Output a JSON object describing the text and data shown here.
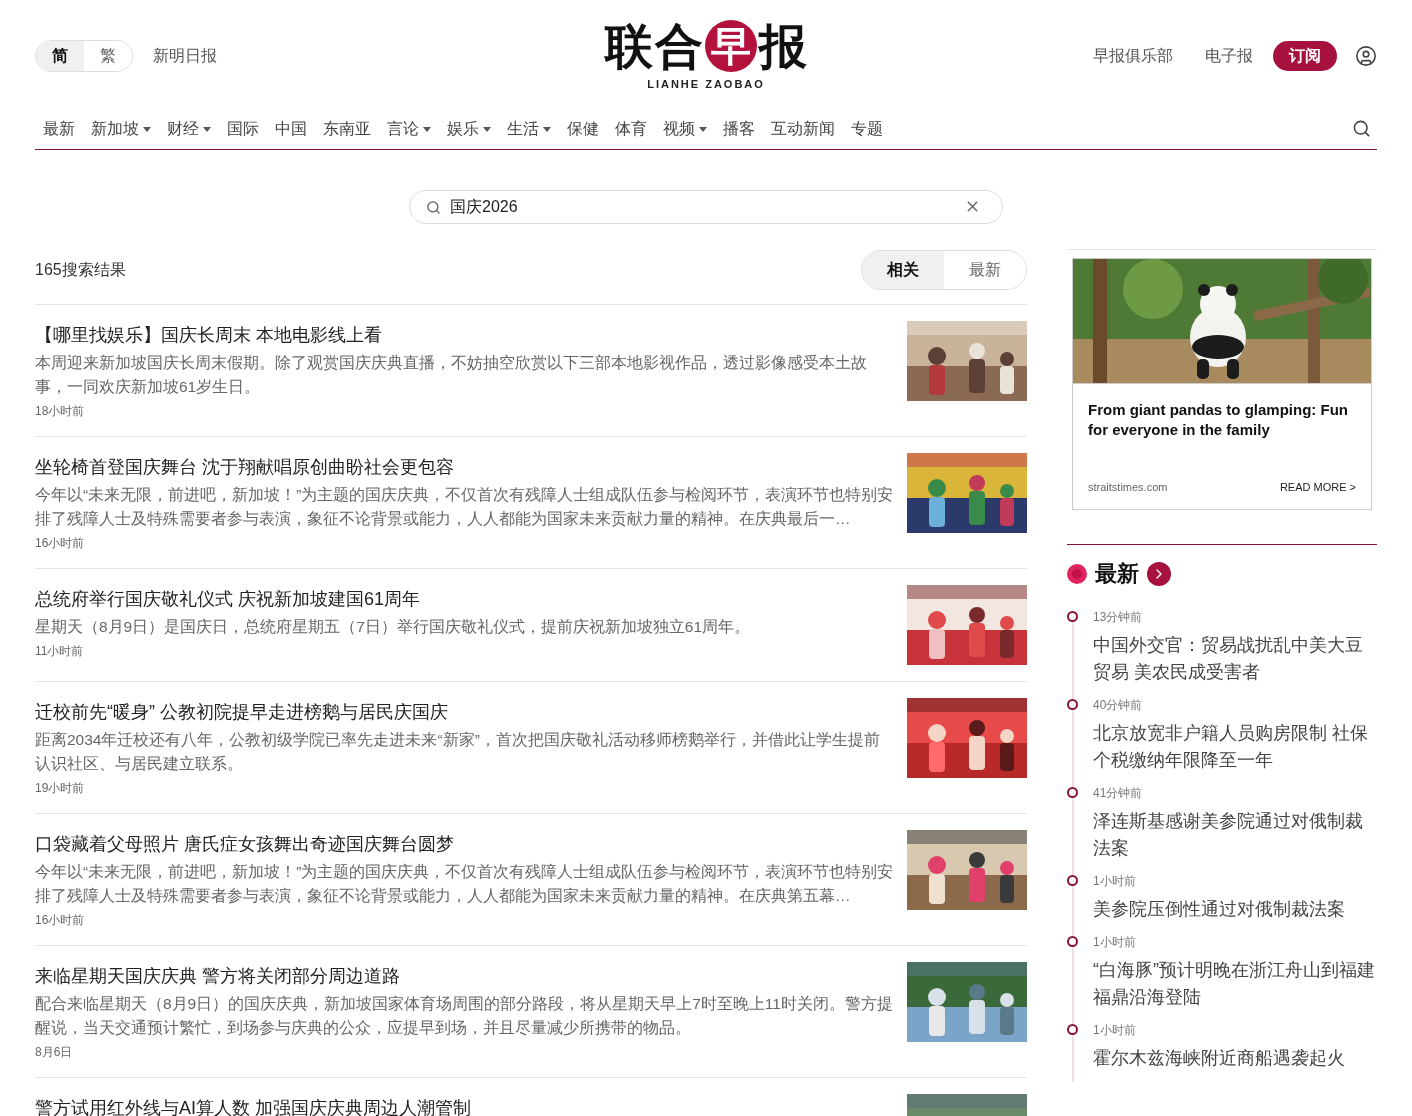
{
  "language_toggle": [
    {
      "label": "简",
      "selected": true
    },
    {
      "label": "繁",
      "selected": false
    }
  ],
  "top_link": "新明日报",
  "logo": {
    "parts": [
      {
        "text": "联",
        "kind": "plain"
      },
      {
        "text": "合",
        "kind": "plain"
      },
      {
        "text": "早",
        "kind": "circled"
      },
      {
        "text": "报",
        "kind": "plain"
      }
    ],
    "subtitle": "LIANHE ZAOBAO"
  },
  "header_links": [
    "早报俱乐部",
    "电子报"
  ],
  "subscribe_button": "订阅",
  "nav": [
    {
      "label": "最新",
      "dropdown": false
    },
    {
      "label": "新加坡",
      "dropdown": true
    },
    {
      "label": "财经",
      "dropdown": true
    },
    {
      "label": "国际",
      "dropdown": false
    },
    {
      "label": "中国",
      "dropdown": false
    },
    {
      "label": "东南亚",
      "dropdown": false
    },
    {
      "label": "言论",
      "dropdown": true
    },
    {
      "label": "娱乐",
      "dropdown": true
    },
    {
      "label": "生活",
      "dropdown": true
    },
    {
      "label": "保健",
      "dropdown": false
    },
    {
      "label": "体育",
      "dropdown": false
    },
    {
      "label": "视频",
      "dropdown": true
    },
    {
      "label": "播客",
      "dropdown": false
    },
    {
      "label": "互动新闻",
      "dropdown": false
    },
    {
      "label": "专题",
      "dropdown": false
    }
  ],
  "search": {
    "value": "国庆2026"
  },
  "results": {
    "count": "165搜索结果",
    "sort": [
      {
        "label": "相关",
        "selected": true
      },
      {
        "label": "最新",
        "selected": false
      }
    ]
  },
  "articles": [
    {
      "title": "【哪里找娱乐】国庆长周末 本地电影线上看",
      "summary": "本周迎来新加坡国庆长周末假期。除了观赏国庆庆典直播，不妨抽空欣赏以下三部本地影视作品，透过影像感受本土故事，一同欢庆新加坡61岁生日。",
      "time": "18小时前"
    },
    {
      "title": "坐轮椅首登国庆舞台 沈于翔献唱原创曲盼社会更包容",
      "summary": "今年以“未来无限，前进吧，新加坡！”为主题的国庆庆典，不仅首次有残障人士组成队伍参与检阅环节，表演环节也特别安排了残障人士及特殊需要者参与表演，象征不论背景或能力，人人都能为国家未来贡献力量的精神。在庆典最后一…",
      "time": "16小时前"
    },
    {
      "title": "总统府举行国庆敬礼仪式 庆祝新加坡建国61周年",
      "summary": "星期天（8月9日）是国庆日，总统府星期五（7日）举行国庆敬礼仪式，提前庆祝新加坡独立61周年。",
      "time": "11小时前"
    },
    {
      "title": "迁校前先“暖身” 公教初院提早走进榜鹅与居民庆国庆",
      "summary": "距离2034年迁校还有八年，公教初级学院已率先走进未来“新家”，首次把国庆敬礼活动移师榜鹅举行，并借此让学生提前认识社区、与居民建立联系。",
      "time": "19小时前"
    },
    {
      "title": "口袋藏着父母照片 唐氏症女孩舞出奇迹国庆舞台圆梦",
      "summary": "今年以“未来无限，前进吧，新加坡！”为主题的国庆庆典，不仅首次有残障人士组成队伍参与检阅环节，表演环节也特别安排了残障人士及特殊需要者参与表演，象征不论背景或能力，人人都能为国家未来贡献力量的精神。在庆典第五幕…",
      "time": "16小时前"
    },
    {
      "title": "来临星期天国庆庆典 警方将关闭部分周边道路",
      "summary": "配合来临星期天（8月9日）的国庆庆典，新加坡国家体育场周围的部分路段，将从星期天早上7时至晚上11时关闭。警方提醒说，当天交通预计繁忙，到场参与庆典的公众，应提早到场，并且尽量减少所携带的物品。",
      "time": "8月6日"
    },
    {
      "title": "警方试用红外线与AI算人数 加强国庆庆典周边人潮管制"
    }
  ],
  "ad": {
    "title": "From giant pandas to glamping: Fun for everyone in the family",
    "source": "straitstimes.com",
    "cta": "READ MORE >"
  },
  "latest": {
    "heading": "最新",
    "items": [
      {
        "time": "13分钟前",
        "title": "中国外交官：贸易战扰乱中美大豆贸易 美农民成受害者"
      },
      {
        "time": "40分钟前",
        "title": "北京放宽非户籍人员购房限制 社保个税缴纳年限降至一年"
      },
      {
        "time": "41分钟前",
        "title": "泽连斯基感谢美参院通过对俄制裁法案"
      },
      {
        "time": "1小时前",
        "title": "美参院压倒性通过对俄制裁法案"
      },
      {
        "time": "1小时前",
        "title": "“白海豚”预计明晚在浙江舟山到福建福鼎沿海登陆"
      },
      {
        "time": "1小时前",
        "title": "霍尔木兹海峡附近商船遇袭起火"
      }
    ]
  }
}
